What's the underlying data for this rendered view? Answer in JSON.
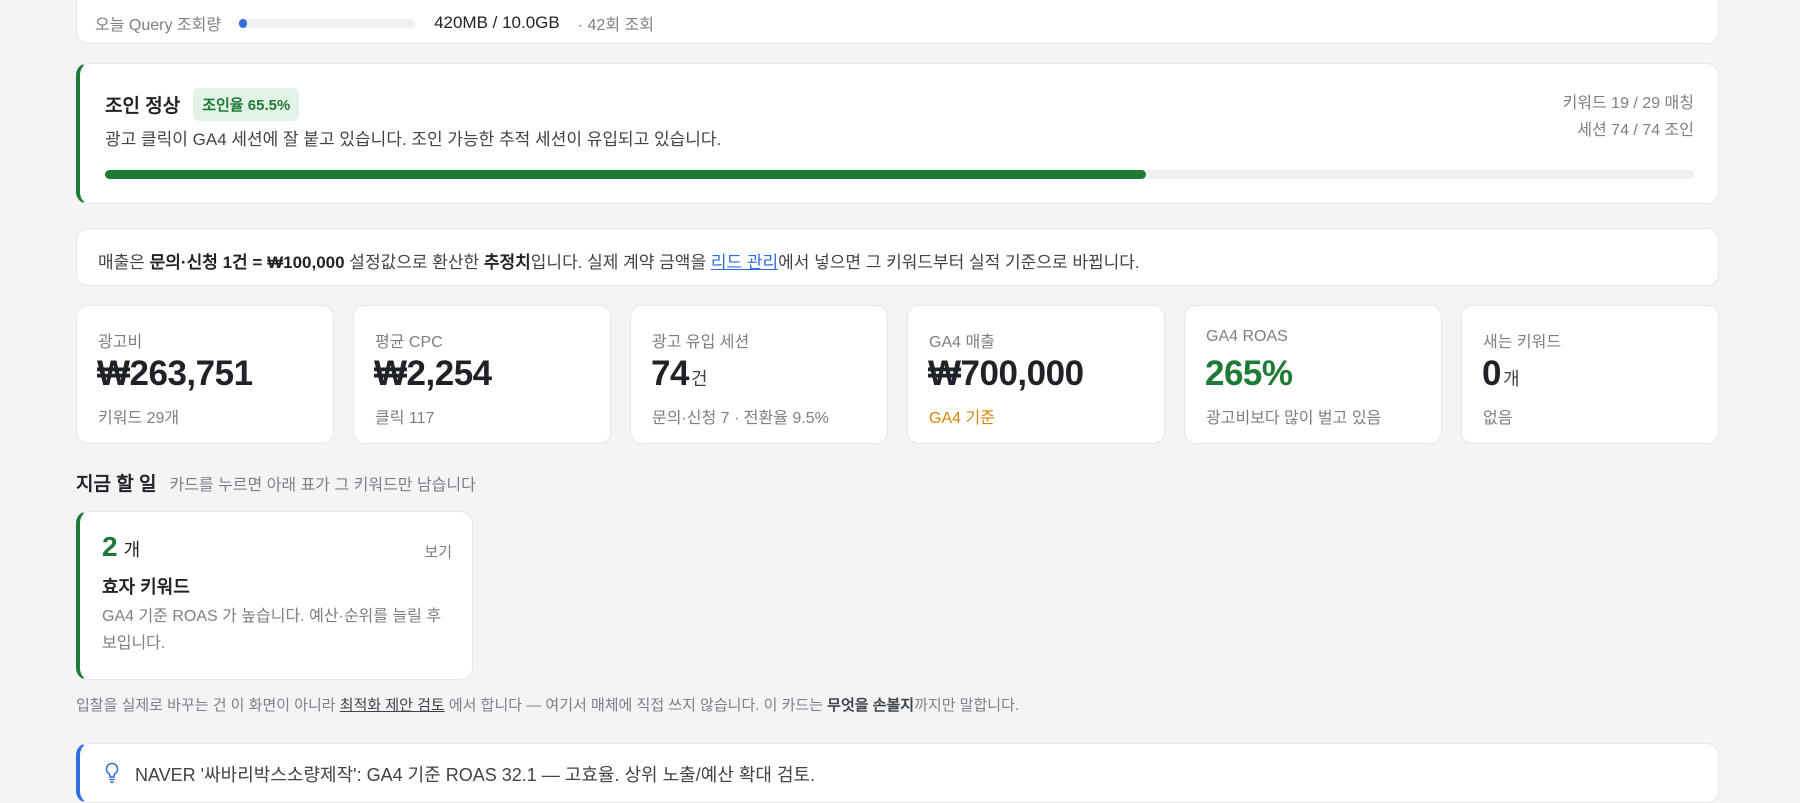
{
  "quota": {
    "label": "오늘 Query 조회량",
    "usage": "420MB / 10.0GB",
    "count": "· 42회 조회",
    "progress_fraction": 0.041
  },
  "join": {
    "title": "조인 정상",
    "badge": "조인율 65.5%",
    "description": "광고 클릭이 GA4 세션에 잘 붙고 있습니다. 조인 가능한 추적 세션이 유입되고 있습니다.",
    "keywords_match": "키워드 19 / 29 매칭",
    "sessions_join": "세션 74 / 74 조인",
    "progress_percent": 65.5
  },
  "notice": {
    "part1": "매출은 ",
    "bold1": "문의·신청 1건 = ₩100,000",
    "part2": " 설정값으로 환산한 ",
    "bold2": "추정치",
    "part3": "입니다. 실제 계약 금액을 ",
    "link": "리드 관리",
    "part4": "에서 넣으면 그 키워드부터 실적 기준으로 바뀝니다."
  },
  "metrics": [
    {
      "label": "광고비",
      "value": "₩263,751",
      "unit": "",
      "sub": "키워드 29개"
    },
    {
      "label": "평균 CPC",
      "value": "₩2,254",
      "unit": "",
      "sub": "클릭 117"
    },
    {
      "label": "광고 유입 세션",
      "value": "74",
      "unit": "건",
      "sub": "문의·신청 7 · 전환율 9.5%"
    },
    {
      "label": "GA4 매출",
      "value": "₩700,000",
      "unit": "",
      "sub": "GA4 기준"
    },
    {
      "label": "GA4 ROAS",
      "value": "265%",
      "unit": "",
      "sub": "광고비보다 많이 벌고 있음"
    },
    {
      "label": "새는 키워드",
      "value": "0",
      "unit": "개",
      "sub": "없음"
    }
  ],
  "todo": {
    "title": "지금 할 일",
    "subtitle": "카드를 누르면 아래 표가 그 키워드만 남습니다",
    "card": {
      "count": "2",
      "unit": "개",
      "view": "보기",
      "title": "효자 키워드",
      "description": "GA4 기준 ROAS 가 높습니다. 예산·순위를 늘릴 후보입니다."
    }
  },
  "footnote": {
    "part1": "입찰을 실제로 바꾸는 건 이 화면이 아니라 ",
    "link": "최적화 제안 검토",
    "part2": " 에서 합니다 — 여기서 매체에 직접 쓰지 않습니다. 이 카드는 ",
    "bold": "무엇을 손볼지",
    "part3": "까지만 말합니다."
  },
  "insight": {
    "icon": "lightbulb-icon",
    "text": "NAVER '싸바리박스소량제작': GA4 기준 ROAS 32.1 — 고효율. 상위 노출/예산 확대 검토."
  },
  "colors": {
    "green": "#1e7a34",
    "blue": "#2f6fe0",
    "orange": "#d9850a"
  }
}
